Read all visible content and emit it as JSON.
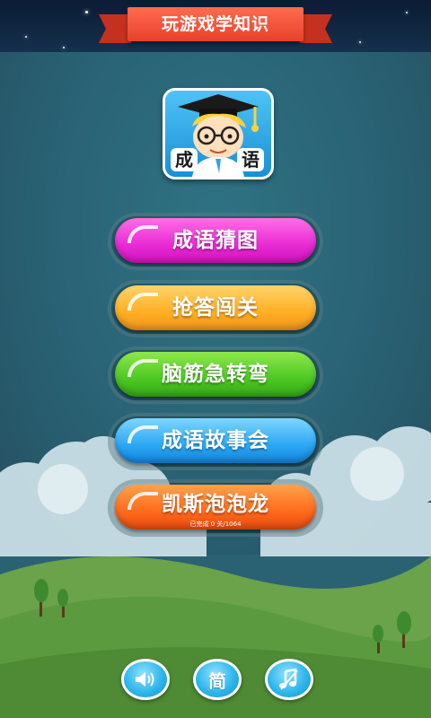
{
  "header": {
    "title": "玩游戏学知识"
  },
  "logo": {
    "badge_left": "成",
    "badge_right": "语",
    "icon": "graduate-boy-logo"
  },
  "menu": [
    {
      "label": "成语猜图",
      "color": "#e92ad4"
    },
    {
      "label": "抢答闯关",
      "color": "#ffaf24"
    },
    {
      "label": "脑筋急转弯",
      "color": "#4cc823"
    },
    {
      "label": "成语故事会",
      "color": "#2ba8f4"
    },
    {
      "label": "凯斯泡泡龙",
      "color": "#ff6a1c",
      "progress": "已完成 0 关/1064"
    }
  ],
  "bottom_bar": {
    "sound_icon": "speaker-icon",
    "lang_label": "简",
    "music_icon": "music-note-icon"
  }
}
